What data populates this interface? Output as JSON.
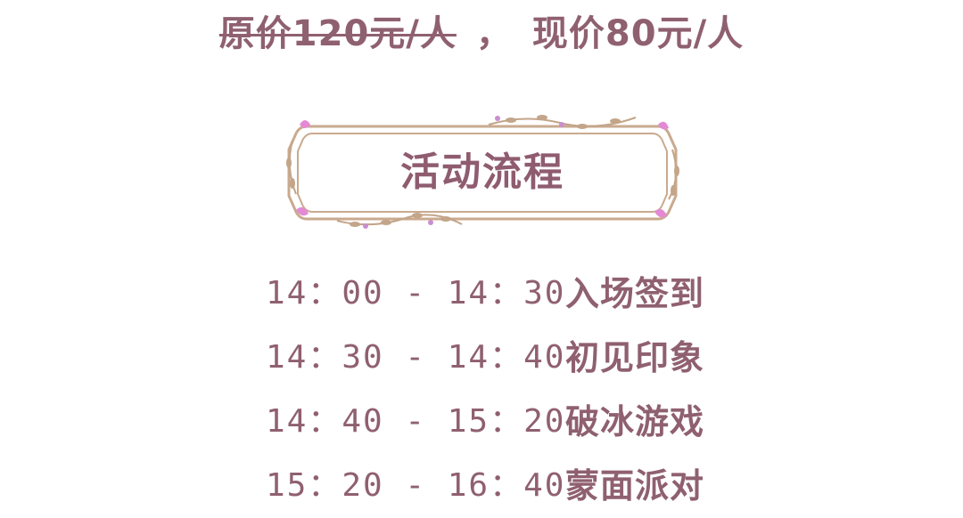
{
  "price": {
    "old": "原价120元/人",
    "separator": "，",
    "current": "现价80元/人"
  },
  "section": {
    "title": "活动流程"
  },
  "schedule": [
    {
      "time": "14：00 - 14：30",
      "activity": "入场签到"
    },
    {
      "time": "14：30 - 14：40",
      "activity": "初见印象"
    },
    {
      "time": "14：40 - 15：20",
      "activity": "破冰游戏"
    },
    {
      "time": "15：20 - 16：40",
      "activity": "蒙面派对"
    }
  ],
  "colors": {
    "text": "#8f6070",
    "frame": "#c9aa8f",
    "flower_pink": "#e48ad4",
    "leaf": "#c3a589"
  }
}
